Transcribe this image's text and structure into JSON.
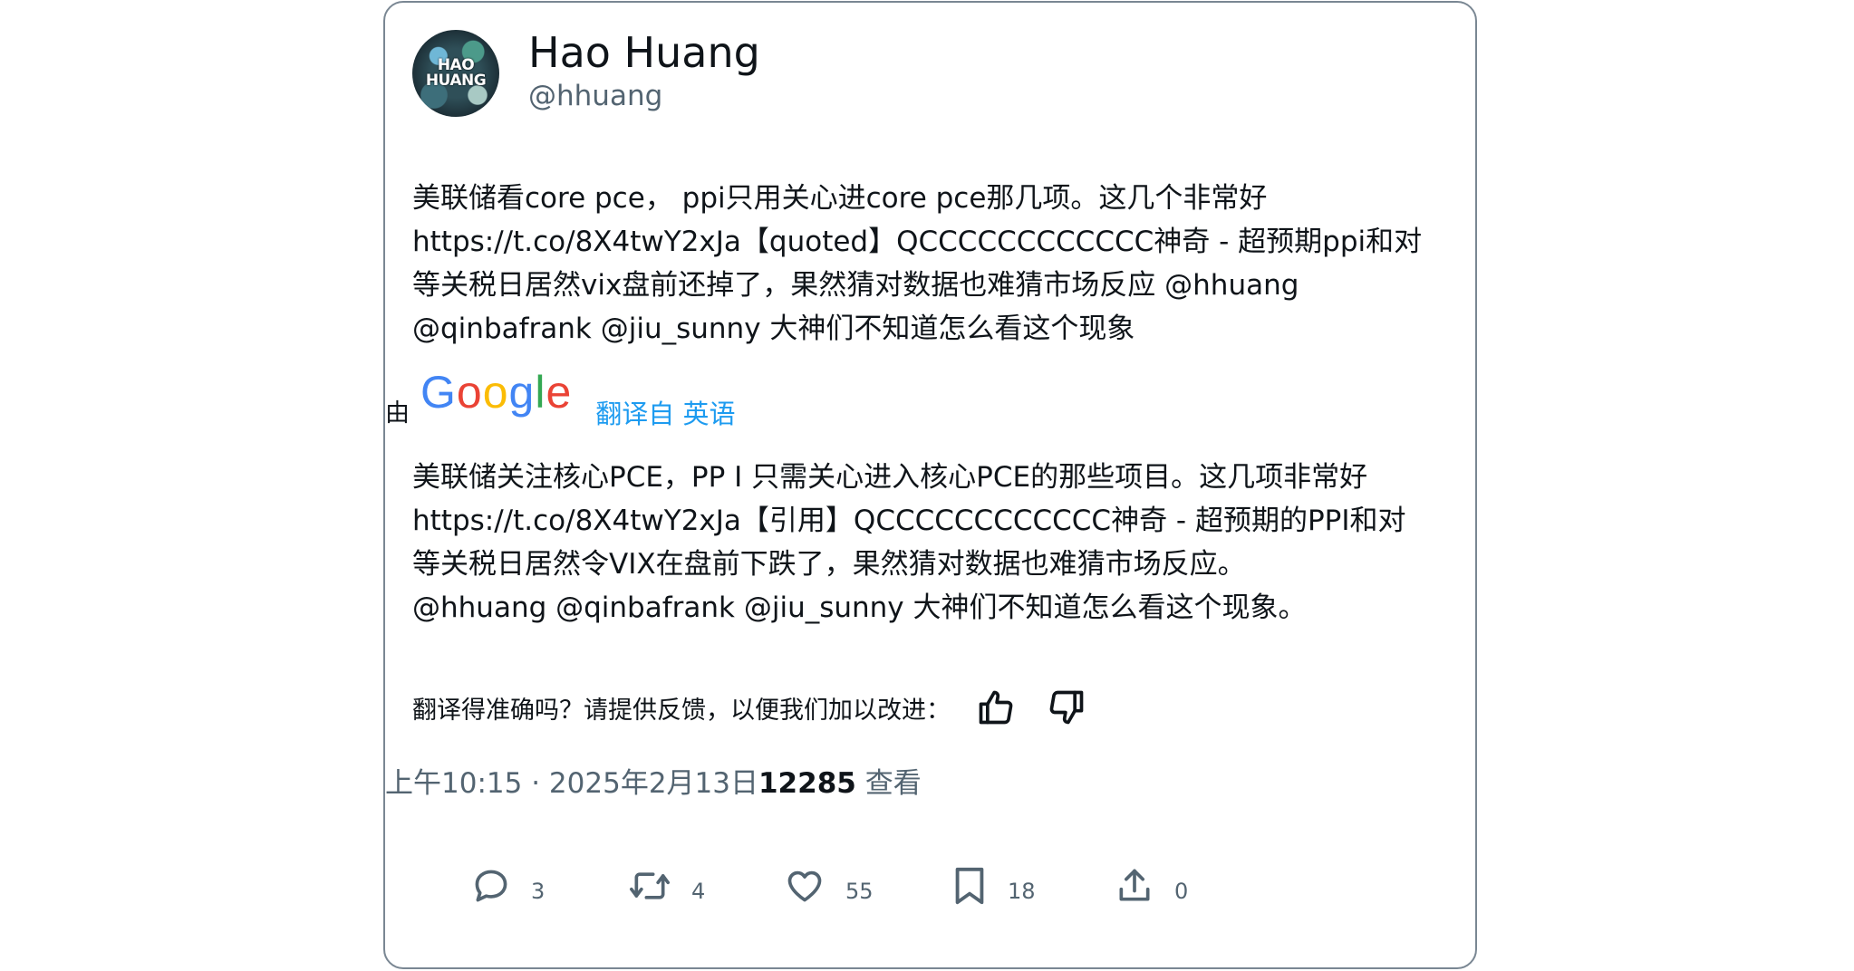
{
  "author": {
    "display_name": "Hao Huang",
    "handle": "@hhuang",
    "avatar_text_line1": "HAO",
    "avatar_text_line2": "HUANG"
  },
  "tweet": {
    "lines": [
      "美联储看core pce， ppi只用关心进core pce那几项。这几个非常好",
      "https://t.co/8X4twY2xJa【quoted】QCCCCCCCCCCCC神奇 - 超预期ppi和对",
      "等关税日居然vix盘前还掉了，果然猜对数据也难猜市场反应 @hhuang",
      "@qinbafrank @jiu_sunny 大神们不知道怎么看这个现象"
    ]
  },
  "translation": {
    "by_label": "由",
    "google_logo": [
      "G",
      "o",
      "o",
      "g",
      "l",
      "e"
    ],
    "link_label": "翻译自 英语",
    "lines": [
      "美联储关注核心PCE，PP I 只需关心进入核心PCE的那些项目。这几项非常好",
      "https://t.co/8X4twY2xJa【引用】QCCCCCCCCCCCC神奇 - 超预期的PPI和对",
      "等关税日居然令VIX在盘前下跌了，果然猜对数据也难猜市场反应。",
      "@hhuang @qinbafrank @jiu_sunny 大神们不知道怎么看这个现象。"
    ],
    "feedback_prompt": "翻译得准确吗？请提供反馈，以便我们加以改进："
  },
  "meta": {
    "time": "上午10:15",
    "separator": "·",
    "date": "2025年2月13日",
    "views_count": "12285",
    "views_label": "查看"
  },
  "actions": {
    "reply_count": "3",
    "retweet_count": "4",
    "like_count": "55",
    "bookmark_count": "18",
    "share_count": "0"
  },
  "icons": {
    "reply": "reply-bubble-icon",
    "retweet": "retweet-icon",
    "like": "heart-icon",
    "bookmark": "bookmark-icon",
    "share": "share-icon",
    "thumbs_up": "thumbs-up-icon",
    "thumbs_down": "thumbs-down-icon"
  },
  "colors": {
    "text": "#0f1419",
    "secondary": "#536471",
    "link": "#1d9bf0",
    "border": "#7a8793"
  }
}
